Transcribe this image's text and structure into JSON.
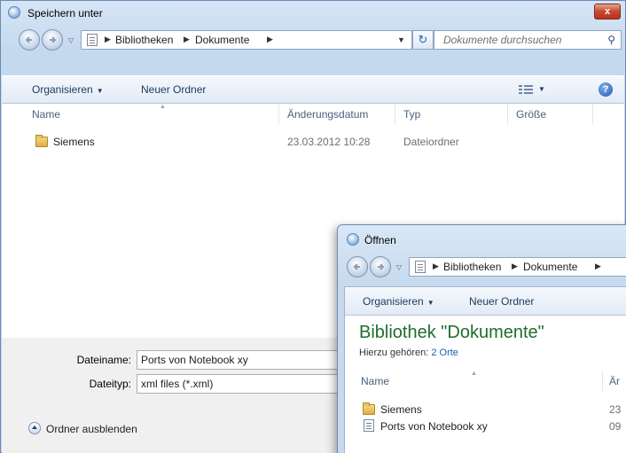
{
  "save_dialog": {
    "title": "Speichern unter",
    "close_label": "x",
    "breadcrumb": [
      "Bibliotheken",
      "Dokumente"
    ],
    "search_placeholder": "Dokumente durchsuchen",
    "toolbar": {
      "organize": "Organisieren",
      "new_folder": "Neuer Ordner"
    },
    "columns": [
      "Name",
      "Änderungsdatum",
      "Typ",
      "Größe"
    ],
    "rows": [
      {
        "name": "Siemens",
        "date": "23.03.2012 10:28",
        "type": "Dateiordner",
        "size": "",
        "icon": "folder-icon"
      }
    ],
    "filename_label": "Dateiname:",
    "filename_value": "Ports von Notebook xy",
    "filetype_label": "Dateityp:",
    "filetype_value": "xml files (*.xml)",
    "hide_folders": "Ordner ausblenden"
  },
  "open_dialog": {
    "title": "Öffnen",
    "breadcrumb": [
      "Bibliotheken",
      "Dokumente"
    ],
    "toolbar": {
      "organize": "Organisieren",
      "new_folder": "Neuer Ordner"
    },
    "library_title": "Bibliothek \"Dokumente\"",
    "includes_label": "Hierzu gehören:",
    "includes_link": "2 Orte",
    "columns": [
      "Name",
      "Är"
    ],
    "rows": [
      {
        "name": "Siemens",
        "date": "23",
        "icon": "folder-icon"
      },
      {
        "name": "Ports von Notebook xy",
        "date": "09",
        "icon": "file-icon"
      }
    ]
  },
  "colors": {
    "title_green": "#1e6e2c",
    "link_blue": "#1a5fb4",
    "close_red": "#c7472e"
  }
}
